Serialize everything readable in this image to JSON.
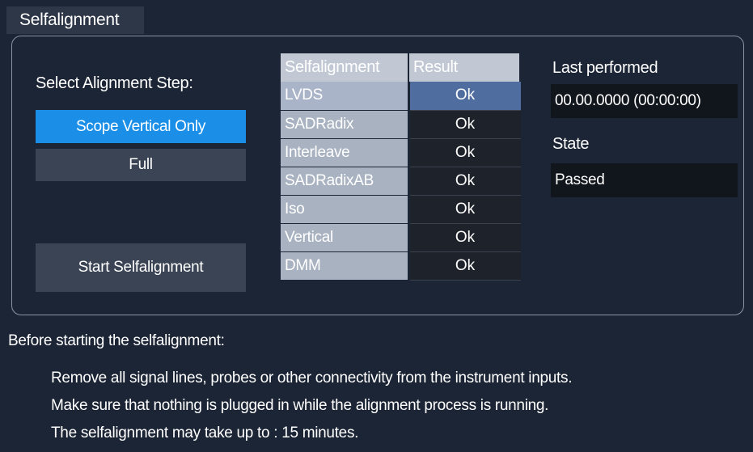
{
  "window": {
    "title": "Selfalignment"
  },
  "alignment_step": {
    "label": "Select Alignment Step:",
    "options": [
      "Scope Vertical Only",
      "Full"
    ],
    "selected": "Scope Vertical Only"
  },
  "start_button": {
    "label": "Start Selfalignment"
  },
  "results_table": {
    "headers": [
      "Selfalignment",
      "Result"
    ],
    "rows": [
      {
        "name": "LVDS",
        "result": "Ok"
      },
      {
        "name": "SADRadix",
        "result": "Ok"
      },
      {
        "name": "Interleave",
        "result": "Ok"
      },
      {
        "name": "SADRadixAB",
        "result": "Ok"
      },
      {
        "name": "Iso",
        "result": "Ok"
      },
      {
        "name": "Vertical",
        "result": "Ok"
      },
      {
        "name": "DMM",
        "result": "Ok"
      }
    ]
  },
  "last_performed": {
    "label": "Last performed",
    "value": "00.00.0000 (00:00:00)"
  },
  "state": {
    "label": "State",
    "value": "Passed"
  },
  "info": {
    "heading": "Before starting the selfalignment:",
    "lines": [
      "Remove all signal lines, probes or other connectivity from the instrument inputs.",
      "Make sure that nothing is plugged in while the alignment process is running.",
      "The selfalignment may take up to :  15 minutes."
    ]
  },
  "colors": {
    "background": "#1c2535",
    "selected_button": "#1b8fe8",
    "button": "#3a4454",
    "table_header": "#c1c8d3",
    "table_name_cell": "#a8b2c1",
    "active_result_cell": "#4f6d9f",
    "value_field": "#11161d"
  }
}
